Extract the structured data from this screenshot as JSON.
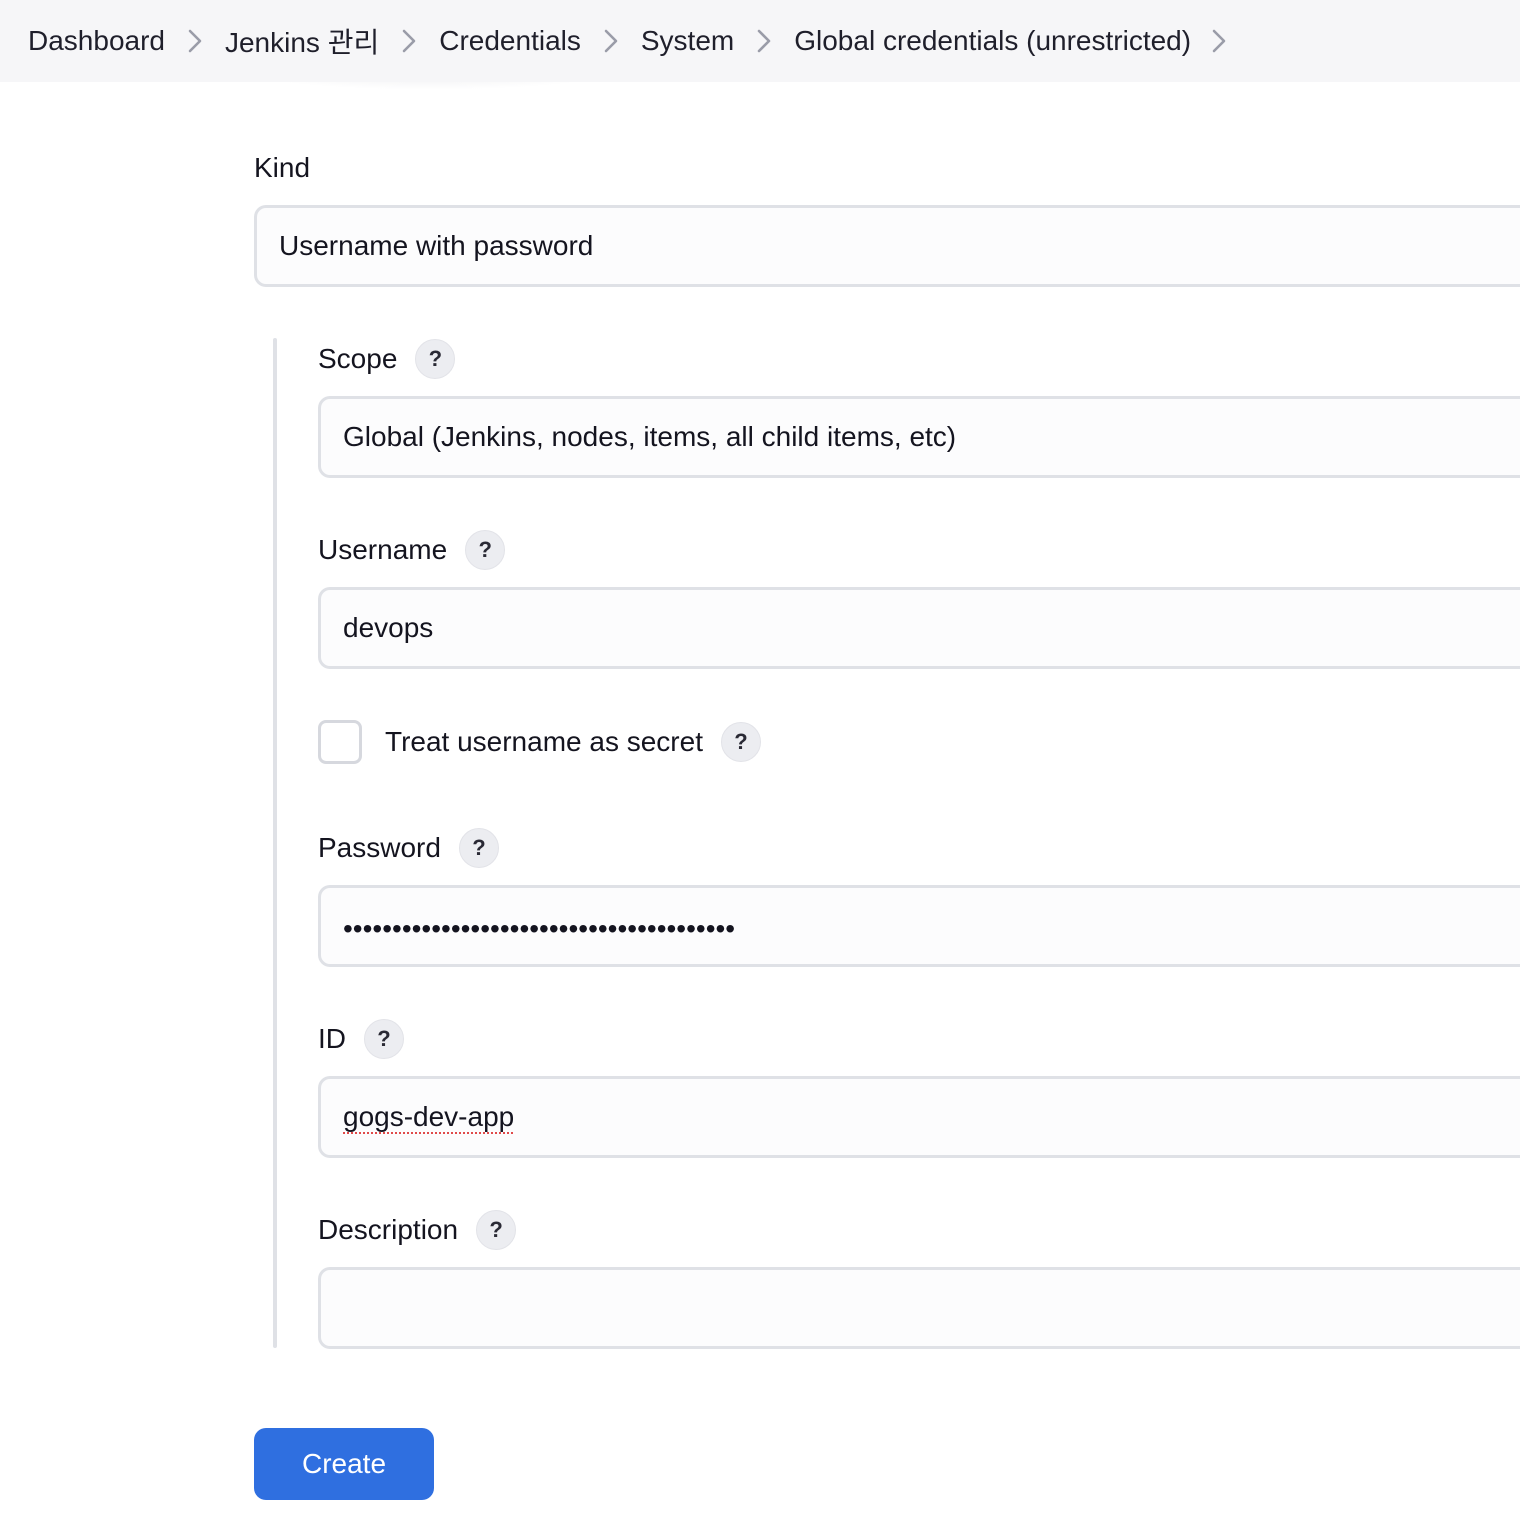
{
  "breadcrumb": {
    "items": [
      {
        "label": "Dashboard"
      },
      {
        "label": "Jenkins 관리"
      },
      {
        "label": "Credentials"
      },
      {
        "label": "System"
      },
      {
        "label": "Global credentials (unrestricted)"
      }
    ],
    "separator_icon": "chevron-right-icon"
  },
  "form": {
    "kind": {
      "label": "Kind",
      "value": "Username with password"
    },
    "scope": {
      "label": "Scope",
      "help": "?",
      "value": "Global (Jenkins, nodes, items, all child items, etc)"
    },
    "username": {
      "label": "Username",
      "help": "?",
      "value": "devops"
    },
    "treat_username_as_secret": {
      "label": "Treat username as secret",
      "help": "?",
      "checked": false
    },
    "password": {
      "label": "Password",
      "help": "?",
      "masked_value": "••••••••••••••••••••••••••••••••••••••••"
    },
    "id": {
      "label": "ID",
      "help": "?",
      "value": "gogs-dev-app"
    },
    "description": {
      "label": "Description",
      "help": "?",
      "value": ""
    }
  },
  "actions": {
    "create_label": "Create"
  },
  "colors": {
    "accent": "#2f6fe0",
    "breadcrumb_bg": "#f6f6f8",
    "field_border": "#dfe1e6"
  }
}
